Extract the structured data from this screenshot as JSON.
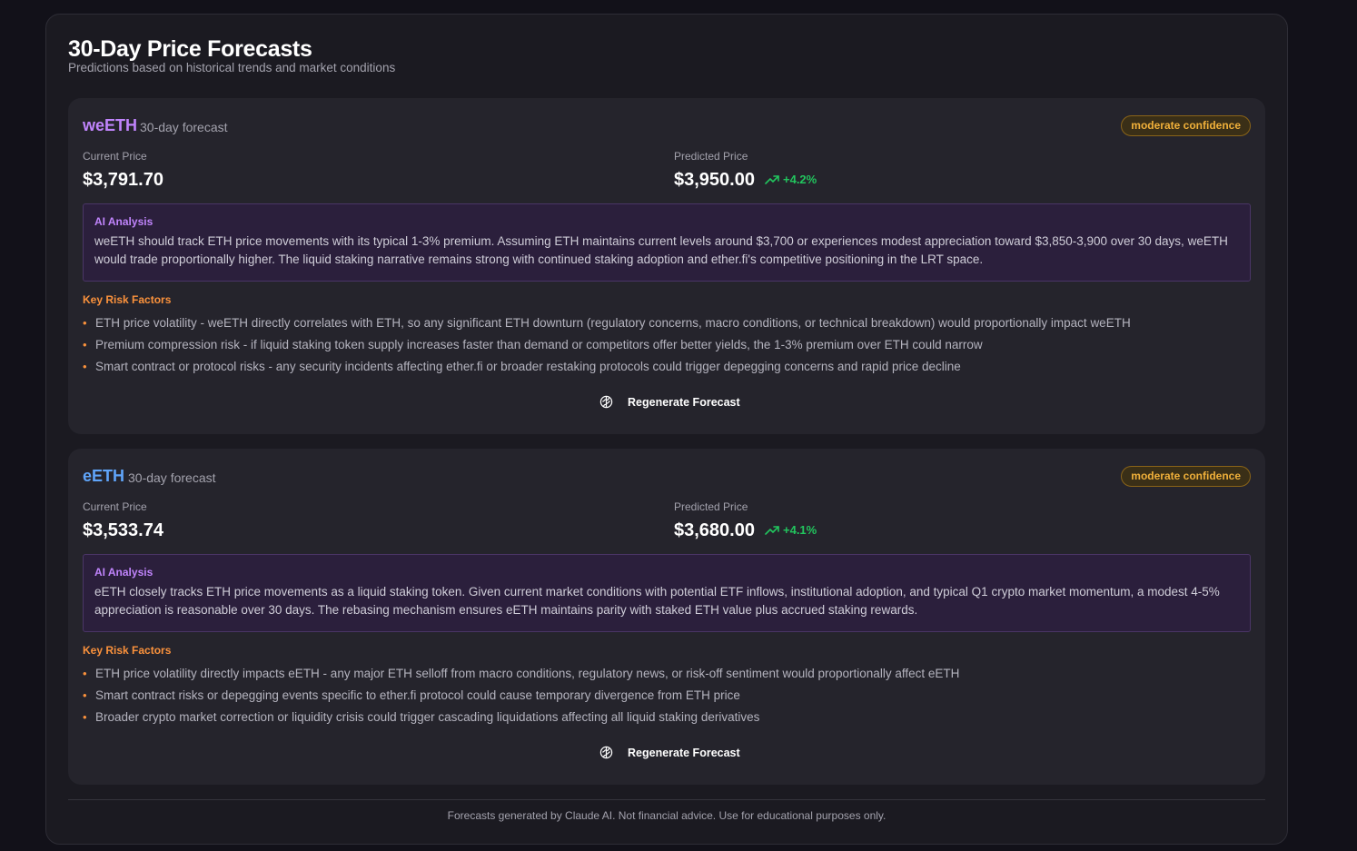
{
  "header": {
    "title": "30-Day Price Forecasts",
    "subtitle": "Predictions based on historical trends and market conditions"
  },
  "forecasts": [
    {
      "token": "weETH",
      "token_color": "#c084fc",
      "horizon": "30-day forecast",
      "confidence": "moderate confidence",
      "current_label": "Current Price",
      "current_price": "$3,791.70",
      "predicted_label": "Predicted Price",
      "predicted_price": "$3,950.00",
      "change": "+4.2%",
      "analysis_title": "AI Analysis",
      "analysis_text": "weETH should track ETH price movements with its typical 1-3% premium. Assuming ETH maintains current levels around $3,700 or experiences modest appreciation toward $3,850-3,900 over 30 days, weETH would trade proportionally higher. The liquid staking narrative remains strong with continued staking adoption and ether.fi's competitive positioning in the LRT space.",
      "risk_title": "Key Risk Factors",
      "risks": [
        "ETH price volatility - weETH directly correlates with ETH, so any significant ETH downturn (regulatory concerns, macro conditions, or technical breakdown) would proportionally impact weETH",
        "Premium compression risk - if liquid staking token supply increases faster than demand or competitors offer better yields, the 1-3% premium over ETH could narrow",
        "Smart contract or protocol risks - any security incidents affecting ether.fi or broader restaking protocols could trigger depegging concerns and rapid price decline"
      ],
      "regenerate_label": "Regenerate Forecast"
    },
    {
      "token": "eETH",
      "token_color": "#60a5fa",
      "horizon": "30-day forecast",
      "confidence": "moderate confidence",
      "current_label": "Current Price",
      "current_price": "$3,533.74",
      "predicted_label": "Predicted Price",
      "predicted_price": "$3,680.00",
      "change": "+4.1%",
      "analysis_title": "AI Analysis",
      "analysis_text": "eETH closely tracks ETH price movements as a liquid staking token. Given current market conditions with potential ETF inflows, institutional adoption, and typical Q1 crypto market momentum, a modest 4-5% appreciation is reasonable over 30 days. The rebasing mechanism ensures eETH maintains parity with staked ETH value plus accrued staking rewards.",
      "risk_title": "Key Risk Factors",
      "risks": [
        "ETH price volatility directly impacts eETH - any major ETH selloff from macro conditions, regulatory news, or risk-off sentiment would proportionally affect eETH",
        "Smart contract risks or depegging events specific to ether.fi protocol could cause temporary divergence from ETH price",
        "Broader crypto market correction or liquidity crisis could trigger cascading liquidations affecting all liquid staking derivatives"
      ],
      "regenerate_label": "Regenerate Forecast"
    }
  ],
  "footer": {
    "disclaimer": "Forecasts generated by Claude AI. Not financial advice. Use for educational purposes only."
  },
  "icons": {
    "trend": "trending-up-icon",
    "regenerate": "brain-icon",
    "bullet": "•"
  },
  "colors": {
    "background": "#121119",
    "panel": "#1b1a21",
    "card": "#25242c",
    "positive": "#22c55e",
    "confidence": "#f0b03a",
    "risk": "#fb923c",
    "ai": "#c084fc"
  }
}
